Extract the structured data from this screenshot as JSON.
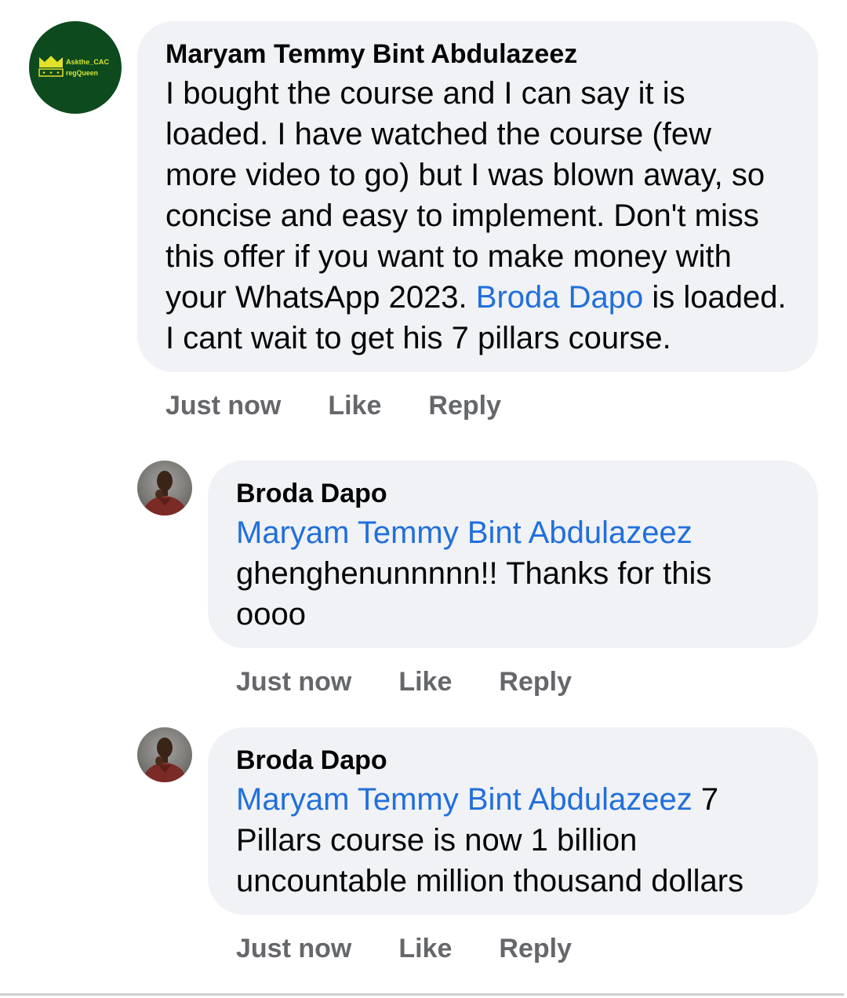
{
  "comment": {
    "author": "Maryam Temmy Bint Abdulazeez",
    "avatar": {
      "logo_line1": "Askthe_CAC",
      "logo_line2": "regQueen",
      "icon": "crown-icon",
      "bg_color": "#0d4a1e",
      "fg_color": "#e3e02c"
    },
    "lines": [
      "I bought the course and I can say it is",
      "loaded. I have watched the course (few",
      "more video to go) but I was blown away, so",
      "concise and easy to implement. Don't miss",
      "this offer if you want to make money with"
    ],
    "mention_line": {
      "before": "your WhatsApp 2023. ",
      "mention": "Broda Dapo",
      "after": " is loaded."
    },
    "last_line": "I cant wait to get his 7 pillars course.",
    "actions": {
      "time": "Just now",
      "like": "Like",
      "reply": "Reply"
    }
  },
  "replies": [
    {
      "author": "Broda Dapo",
      "mention": "Maryam Temmy Bint Abdulazeez",
      "lines": [
        "ghenghenunnnnn!! Thanks for this",
        "oooo"
      ],
      "actions": {
        "time": "Just now",
        "like": "Like",
        "reply": "Reply"
      }
    },
    {
      "author": "Broda Dapo",
      "mention": "Maryam Temmy Bint Abdulazeez",
      "mention_after": " 7",
      "lines": [
        "Pillars course is now 1 billion",
        "uncountable million thousand dollars"
      ],
      "actions": {
        "time": "Just now",
        "like": "Like",
        "reply": "Reply"
      }
    }
  ],
  "colors": {
    "bubble": "#f0f2f5",
    "text": "#050505",
    "link": "#216fdb",
    "meta": "#65676b"
  }
}
